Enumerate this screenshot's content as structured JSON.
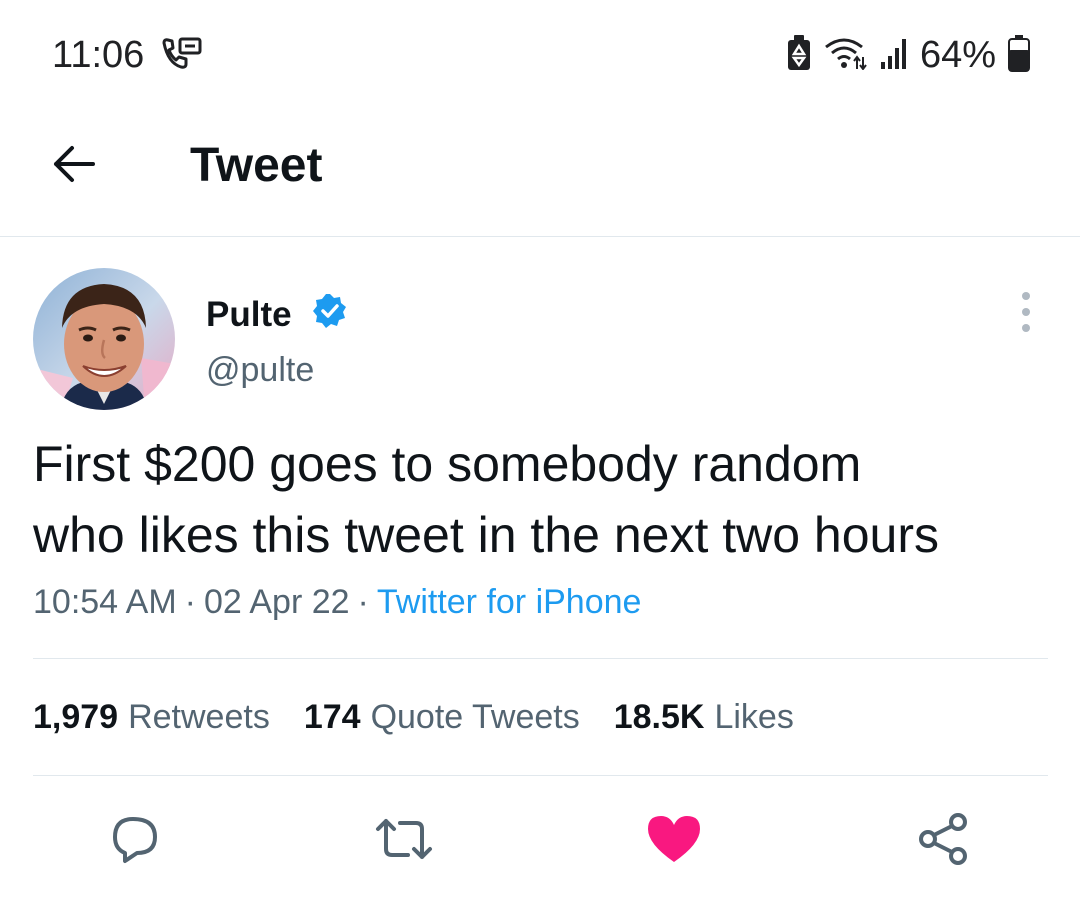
{
  "status_bar": {
    "time": "11:06",
    "battery_percent": "64%",
    "icons": [
      "voicemail-icon",
      "battery-saver-icon",
      "wifi-icon",
      "signal-icon",
      "battery-icon"
    ]
  },
  "header": {
    "title": "Tweet",
    "back_icon": "arrow-left-icon"
  },
  "tweet": {
    "author": {
      "display_name": "Pulte",
      "handle": "@pulte",
      "verified": true
    },
    "text_lines": [
      "First $200 goes to somebody random",
      "who likes this tweet in the next two hours"
    ],
    "time": "10:54 AM",
    "date": "02 Apr 22",
    "separator": "·",
    "source": "Twitter for iPhone",
    "stats": {
      "retweets_count": "1,979",
      "retweets_label": "Retweets",
      "quotes_count": "174",
      "quotes_label": "Quote Tweets",
      "likes_count": "18.5K",
      "likes_label": "Likes"
    },
    "actions": [
      "reply-icon",
      "retweet-icon",
      "like-icon",
      "share-icon"
    ]
  },
  "colors": {
    "accent": "#1d9bf0",
    "like": "#f91880",
    "text_primary": "#0f1419",
    "text_secondary": "#536471",
    "divider": "#e1e8ed"
  }
}
